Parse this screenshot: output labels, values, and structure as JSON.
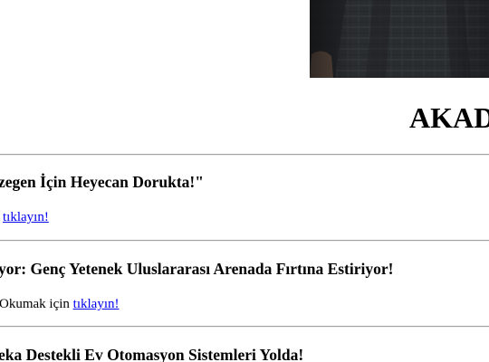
{
  "section": {
    "title": "AKAD"
  },
  "articles": [
    {
      "headline": "zegen İçin Heyecan Dorukta!\"",
      "prefix": "",
      "link": "tıklayın!"
    },
    {
      "headline": "yor: Genç Yetenek Uluslararası Arenada Fırtına Estiriyor!",
      "prefix": "Okumak için ",
      "link": "tıklayın!"
    },
    {
      "headline": "eka Destekli Ev Otomasyon Sistemleri Yolda!",
      "prefix": "",
      "link": ""
    }
  ],
  "colors": {
    "link": "#0000ee",
    "divider": "#a0a0a0",
    "photo_bg": "#2b2e31"
  },
  "icons": {
    "photo": "person-in-plaid-jacket-photo"
  }
}
